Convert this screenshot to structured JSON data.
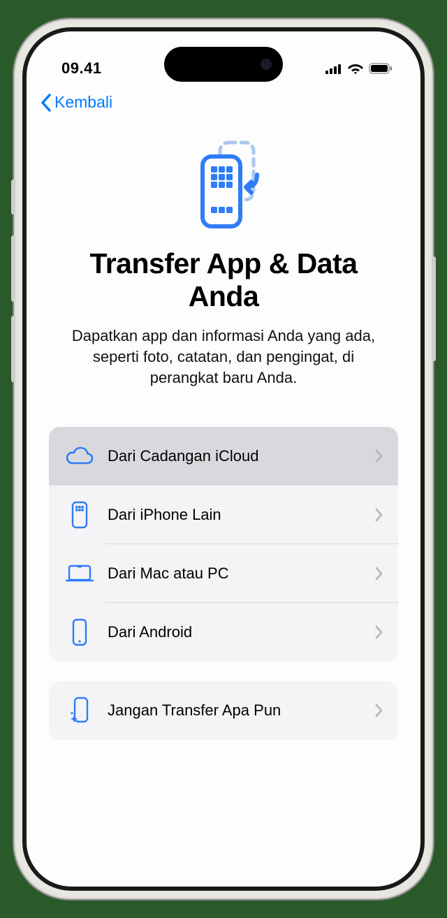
{
  "status": {
    "time": "09.41"
  },
  "nav": {
    "back_label": "Kembali"
  },
  "header": {
    "title": "Transfer App & Data Anda",
    "subtitle": "Dapatkan app dan informasi Anda yang ada, seperti foto, catatan, dan pengingat, di perangkat baru Anda."
  },
  "options": {
    "icloud": "Dari Cadangan iCloud",
    "iphone": "Dari iPhone Lain",
    "mac": "Dari Mac atau PC",
    "android": "Dari Android",
    "none": "Jangan Transfer Apa Pun"
  }
}
